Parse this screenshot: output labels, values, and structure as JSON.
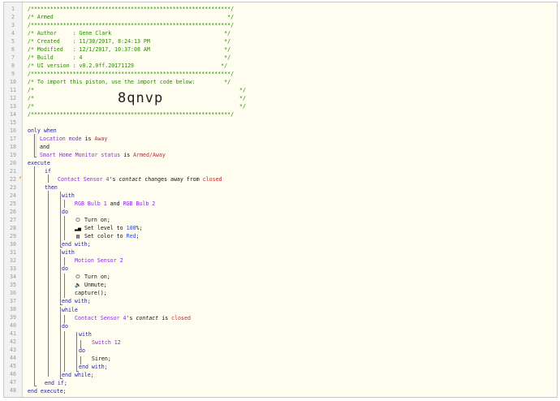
{
  "line_numbers": [
    "1",
    "2",
    "3",
    "4",
    "5",
    "6",
    "7",
    "8",
    "9",
    "10",
    "11",
    "12",
    "13",
    "14",
    "15",
    "16",
    "17",
    "18",
    "19",
    "20",
    "21",
    "22",
    "23",
    "24",
    "25",
    "26",
    "27",
    "28",
    "29",
    "30",
    "31",
    "32",
    "33",
    "34",
    "35",
    "36",
    "37",
    "38",
    "39",
    "40",
    "41",
    "42",
    "43",
    "44",
    "45",
    "46",
    "47",
    "48"
  ],
  "marker": "⚡",
  "header": {
    "rule": "/**************************************************************/",
    "title": "/* Armed                                                      */",
    "author": "/* Author     : Gene Clark                                   */",
    "created": "/* Created    : 11/30/2017, 8:24:13 PM                       */",
    "modified": "/* Modified   : 12/1/2017, 10:37:08 AM                       */",
    "build": "/* Build      : 4                                            */",
    "ui_version": "/* UI version : v0.2.0ff.20171129                           */",
    "import_note": "/* To import this piston, use the import code below:         */",
    "blank_open": "/*",
    "blank_close": "*/",
    "import_code": "8qnvp"
  },
  "code": {
    "only_when": "only when",
    "location_mode": "Location mode",
    "is": " is ",
    "away": "Away",
    "and": "and",
    "shm_status": "Smart Home Monitor status",
    "armed_away": "Armed/Away",
    "execute": "execute",
    "if": "if",
    "contact_sensor": "Contact Sensor 4",
    "possessive": "'s ",
    "contact": "contact",
    "changes_away_from": " changes away from ",
    "closed": "closed",
    "then": "then",
    "with": "with",
    "rgb_bulb_1": "RGB Bulb 1",
    "and_sep": " and ",
    "rgb_bulb_2": "RGB Bulb 2",
    "do": "do",
    "turn_on": "Turn on;",
    "set_level": "Set level to ",
    "level_value": "100",
    "level_suffix": "%;",
    "set_color": "Set color to ",
    "red": "Red",
    "semicolon": ";",
    "end_with": "end with;",
    "motion_sensor": "Motion Sensor 2",
    "unmute": "Unmute;",
    "capture": "capture();",
    "while": "while",
    "is_closed_pre": " is ",
    "switch": "Switch 12",
    "siren": "Siren;",
    "end_while": "end while;",
    "end_if": "end if;",
    "end_execute": "end execute;"
  },
  "icons": {
    "power": "power-icon",
    "level": "signal-bars-icon",
    "color": "color-swatch-icon",
    "volume": "volume-icon"
  }
}
